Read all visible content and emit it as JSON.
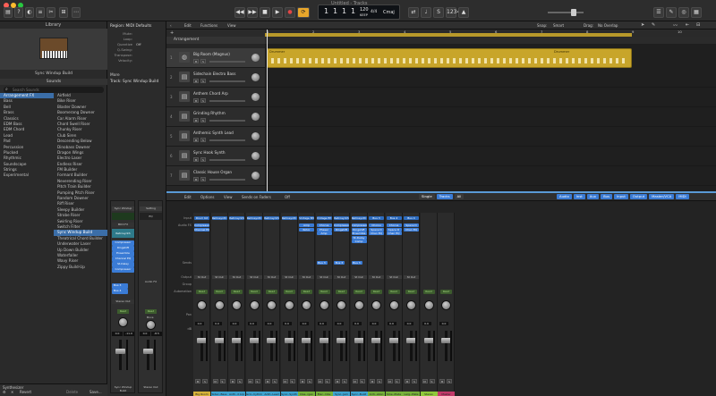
{
  "window": {
    "title": "Untitled - Tracks"
  },
  "toolbar": {
    "lcd": {
      "bar": "1",
      "beat": "1",
      "sub": "1",
      "tick": "1",
      "tempo": "120",
      "tempo_mode": "KEEP",
      "time_sig": "4/4",
      "key": "Cmaj"
    },
    "accent": "#e8a62b"
  },
  "library": {
    "title": "Library",
    "preset_name": "Sync Windup Build",
    "sounds_header": "Sounds",
    "search_placeholder": "Search Sounds",
    "categories": [
      "Arrangement FX",
      "Bass",
      "Bell",
      "Brass",
      "Classics",
      "EDM Bass",
      "EDM Chord",
      "Lead",
      "Pad",
      "Percussion",
      "Plucked",
      "Rhythmic",
      "Soundscape",
      "Strings",
      "Experimental"
    ],
    "presets": [
      "Airfield",
      "Bike Riser",
      "Blaster Downer",
      "Boomerang Downer",
      "Car Alarm Riser",
      "Chord Swell Riser",
      "Chunky Riser",
      "Club Siren",
      "Descending Below",
      "Dinobass Downer",
      "Dragon Wings",
      "Electro Laser",
      "Endless Riser",
      "FM Builder",
      "Formant Builder",
      "Neverending Riser",
      "Pitch Train Builder",
      "Pumping Pitch Riser",
      "Random Downer",
      "Riff Riser",
      "Sleepy Builder",
      "Strobe Riser",
      "Swirling Riser",
      "Switch Filter",
      "Sync Windup Build",
      "Theatrical Chord Builder",
      "Underwater Laser",
      "Up Down Builder",
      "Waterfaller",
      "Wavy Riser",
      "Zippy Build-Up"
    ],
    "footer": {
      "synth": "Synthesizer",
      "revert": "Revert",
      "delete": "Delete",
      "save": "Save..."
    }
  },
  "inspector": {
    "region_header": "Region: MIDI Defaults",
    "fields": [
      {
        "label": "Mute:",
        "value": ""
      },
      {
        "label": "Loop:",
        "value": ""
      },
      {
        "label": "Quantize",
        "value": "Off"
      },
      {
        "label": "Q-Swing:",
        "value": ""
      },
      {
        "label": "Transpose:",
        "value": ""
      },
      {
        "label": "Velocity:",
        "value": ""
      }
    ],
    "more": "More",
    "track_header": "Track: Sync Windup Build",
    "strip_left": {
      "setting": "Sync Windup",
      "eq": "EQ",
      "midi_fx": "MIDI FX",
      "instrument": "Retrosynth",
      "fx": [
        "Compressor",
        "Ringshift",
        "Ensemble",
        "Channel EQ",
        "St-Delay",
        "Compressor"
      ],
      "sends": [
        "Bus 3",
        "Bus 4"
      ],
      "output": "Stereo Out",
      "automation": "Read",
      "volume": "0.0",
      "peak": "-11.0",
      "name": "Sync Windup Build"
    },
    "strip_right": {
      "setting": "Setting",
      "eq": "EQ",
      "audio_fx": "Audio FX",
      "output": "",
      "automation": "Read",
      "volume": "0.0",
      "peak": "-8.5",
      "name": "Stereo Out",
      "bnce": "Bnce"
    }
  },
  "tracks_area": {
    "edit": "Edit",
    "functions": "Functions",
    "view": "View",
    "snap": "Snap:",
    "snap_value": "Smart",
    "drag": "Drag:",
    "drag_value": "No Overlap",
    "arrangement": "Arrangement",
    "ruler": [
      "1",
      "2",
      "3",
      "4",
      "5",
      "6",
      "7",
      "8",
      "9",
      "10",
      "11"
    ],
    "tracks": [
      {
        "num": "1",
        "name": "Big Room (Magnus)"
      },
      {
        "num": "2",
        "name": "Sidechain Electro Bass"
      },
      {
        "num": "3",
        "name": "Anthem Chord Arp"
      },
      {
        "num": "4",
        "name": "Grinding Rhythm"
      },
      {
        "num": "5",
        "name": "Anthemic Synth Lead"
      },
      {
        "num": "6",
        "name": "Sync Hook Synth"
      },
      {
        "num": "7",
        "name": "Classic House Organ"
      }
    ],
    "region_labels": [
      "Drummer",
      "Drummer"
    ],
    "region_color": "#c8a52a"
  },
  "mixer": {
    "edit": "Edit",
    "options": "Options",
    "view": "View",
    "sends_label": "Sends on Faders",
    "sends_value": "Off",
    "views": [
      "Single",
      "Tracks",
      "All"
    ],
    "filters": [
      "Audio",
      "Inst",
      "Aux",
      "Bus",
      "Input",
      "Output",
      "Master/VCA",
      "MIDI"
    ],
    "row_labels": [
      "Input",
      "Audio FX",
      "Sends",
      "Output",
      "Group",
      "Automation",
      "",
      "Pan",
      "dB"
    ],
    "strips": [
      {
        "name": "Big Room",
        "input": "Drum Kit",
        "fx": [
          "Compressor",
          "Channel EQ"
        ],
        "send": "",
        "output": "St Out",
        "vol": "0.0",
        "color": "#d6b23a"
      },
      {
        "name": "Sidec..Bass",
        "input": "Retrosynth",
        "fx": [],
        "send": "",
        "output": "St Out",
        "vol": "0.0",
        "color": "#3ea3d0"
      },
      {
        "name": "Anth..d Arp",
        "input": "Retrosynth",
        "fx": [],
        "send": "",
        "output": "St Out",
        "vol": "0.0",
        "color": "#3ea3d0"
      },
      {
        "name": "Grin..hythm",
        "input": "Retrosynth",
        "fx": [],
        "send": "",
        "output": "St Out",
        "vol": "0.0",
        "color": "#3ea3d0"
      },
      {
        "name": "Anth..Lead",
        "input": "Retrosynth",
        "fx": [],
        "send": "",
        "output": "St Out",
        "vol": "0.0",
        "color": "#3ea3d0"
      },
      {
        "name": "Sync..Synth",
        "input": "Retrosynth",
        "fx": [],
        "send": "",
        "output": "St Out",
        "vol": "0.0",
        "color": "#3ea3d0"
      },
      {
        "name": "Clas..rgan",
        "input": "Vintage B3",
        "fx": [
          "Amp",
          "Rotor"
        ],
        "send": "",
        "output": "St Out",
        "vol": "0.0",
        "color": "#77b23a"
      },
      {
        "name": "Elec..mbs",
        "input": "Vintage EP",
        "fx": [
          "Chorus",
          "Phaser",
          "Amp"
        ],
        "send": "Bus 3",
        "output": "St Out",
        "vol": "0.0",
        "color": "#77b23a"
      },
      {
        "name": "Sync..Jam",
        "input": "Retrosynth",
        "fx": [
          "Compressor",
          "Ringshift"
        ],
        "send": "Bus 3",
        "output": "St Out",
        "vol": "0.0",
        "color": "#3ea3d0"
      },
      {
        "name": "Sync..Build",
        "input": "Retrosynth",
        "fx": [
          "Compressor",
          "Ringshift",
          "Ensemble",
          "St-Delay",
          "Comp"
        ],
        "send": "Bus 3",
        "output": "St Out",
        "vol": "0.0",
        "color": "#3ea3d0"
      },
      {
        "name": "Arrh..ation",
        "input": "Bus 3",
        "fx": [
          "Chorus",
          "Space D",
          "Chan EQ"
        ],
        "send": "",
        "output": "St Out",
        "vol": "0.0",
        "color": "#77b23a"
      },
      {
        "name": "Sme..Plate",
        "input": "Bus 4",
        "fx": [
          "Chorus",
          "Space D",
          "Chan EQ"
        ],
        "send": "",
        "output": "St Out",
        "vol": "0.0",
        "color": "#77b23a"
      },
      {
        "name": "Larg..Plate",
        "input": "Bus 4",
        "fx": [
          "Space D",
          "Chan EQ"
        ],
        "send": "",
        "output": "St Out",
        "vol": "0.0",
        "color": "#77b23a"
      },
      {
        "name": "Stereo",
        "input": "",
        "fx": [],
        "send": "",
        "output": "",
        "vol": "0.0",
        "color": "#8fc93a"
      },
      {
        "name": "Master",
        "input": "",
        "fx": [],
        "send": "",
        "output": "",
        "vol": "0.0",
        "color": "#c23a6a"
      }
    ],
    "read": "Read",
    "master_label": "Master"
  }
}
